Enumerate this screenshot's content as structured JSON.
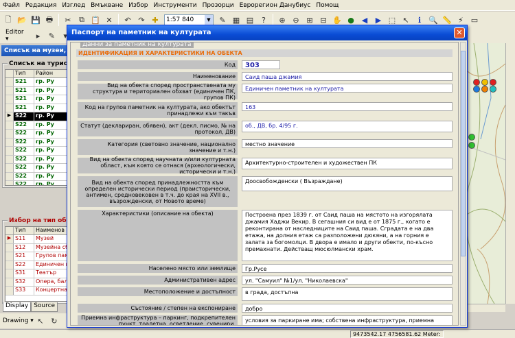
{
  "menu": [
    "Файл",
    "Редакция",
    "Изглед",
    "Вмъкване",
    "Избор",
    "Инструменти",
    "Прозорци",
    "Еврорегион Данубиус",
    "Помощ"
  ],
  "toolbar": {
    "scale": "1:57 840"
  },
  "editor_label": "Editor",
  "left_panel": {
    "title": "Списък на музеи, п",
    "group1_label": "Списък на туристи",
    "group1_cols": [
      "Тип",
      "Район"
    ],
    "group1_rows": [
      {
        "type": "S21",
        "area": "гр. Ру",
        "color": "#006400"
      },
      {
        "type": "S21",
        "area": "гр. Ру",
        "color": "#006400"
      },
      {
        "type": "S21",
        "area": "гр. Ру",
        "color": "#006400"
      },
      {
        "type": "S21",
        "area": "гр. Ру",
        "color": "#006400"
      },
      {
        "type": "S22",
        "area": "гр. Ру",
        "color": "#006400",
        "selected": true
      },
      {
        "type": "S22",
        "area": "гр. Ру",
        "color": "#006400"
      },
      {
        "type": "S22",
        "area": "гр. Ру",
        "color": "#006400"
      },
      {
        "type": "S22",
        "area": "гр. Ру",
        "color": "#006400"
      },
      {
        "type": "S22",
        "area": "гр. Ру",
        "color": "#006400"
      },
      {
        "type": "S22",
        "area": "гр. Ру",
        "color": "#006400"
      },
      {
        "type": "S22",
        "area": "гр. Ру",
        "color": "#006400"
      },
      {
        "type": "S22",
        "area": "гр. Ру",
        "color": "#006400"
      },
      {
        "type": "S22",
        "area": "гр. Ру",
        "color": "#006400"
      }
    ],
    "group2_label": "Избор на тип обект",
    "group2_cols": [
      "Тип",
      "Наименов"
    ],
    "group2_rows": [
      {
        "type": "S11",
        "name": "Музей",
        "color": "#b00000",
        "current": true
      },
      {
        "type": "S12",
        "name": "Музейна сбі",
        "color": "#b00000"
      },
      {
        "type": "S21",
        "name": "Групов памі",
        "color": "#b00000"
      },
      {
        "type": "S22",
        "name": "Единичен пі",
        "color": "#b00000"
      },
      {
        "type": "S31",
        "name": "Театър",
        "color": "#b00000"
      },
      {
        "type": "S32",
        "name": "Опера, бал",
        "color": "#b00000"
      },
      {
        "type": "S33",
        "name": "Концертна",
        "color": "#b00000"
      }
    ],
    "tabs": [
      "Display",
      "Source"
    ]
  },
  "drawing_label": "Drawing",
  "status": {
    "coords": "9473542.17  4756581.62 Meter:"
  },
  "dialog": {
    "title": "Паспорт на паметник на културата",
    "legend": "Данни за паметник на културата",
    "section": "ИДЕНТИФИКАЦИЯ И ХАРАКТЕРИСТИКИ НА ОБЕКТА",
    "rows": [
      {
        "label": "Код",
        "value": "303"
      },
      {
        "label": "Наименование",
        "value": "Саид паша джамия"
      },
      {
        "label": "Вид на обекта според пространствената му структура и териториален обхват (единичен ПК, групов ПК)",
        "value": "Единичен паметник на културата"
      },
      {
        "label": "Код на групов паметник на културата, ако обектът принадлежи към такъв",
        "value": "163"
      },
      {
        "label": "Статут (деклариран, обявен), акт (декл. писмо, № на протокол, ДВ)",
        "value": "об., ДВ, бр. 4/95 г."
      },
      {
        "label": "Категория (световно значение, национално значение и т.н.)",
        "value": "местно значение"
      },
      {
        "label": "Вид на обекта според научната и/или културната област, към която се отнася (археологически, исторически и т.н.)",
        "value": "Архитектурно-строителен и художествен ПК"
      },
      {
        "label": "Вид на обекта според принадлежността към определен исторически период (праисторически, антимен, средновековен в т.ч. до края на XVII в., възрожденски, от Новото време)",
        "value": "Доосвобожденски ( Възраждане)"
      },
      {
        "label": "Характеристики (описание на обекта)",
        "value": "Построена през 1839 г. от Саид паша на мястото на изгорялата джамия Хаджи Векир. В сегашния си вид е от 1875 г., когато е реконтирана от наследниците на Саид паша. Сградата е на два етажа, на долния етаж са разположени дюкяни, а на горния е залата за богомолци. В двора е имало и други обекти, по-късно премахнати. Действащ мюсюлмански храм."
      },
      {
        "label": "Населено място или землище",
        "value": "Гр.Русе"
      },
      {
        "label": "Административен адрес",
        "value": "ул. \"Самуил\" №1/ул. \"Николаевска\""
      },
      {
        "label": "Местоположение и достъпност",
        "value": "в града, достъпна"
      },
      {
        "label": "Състояние / степен на експониране",
        "value": "добро"
      },
      {
        "label": "Приемна инфраструктура – паркинг, подкрепителен пункт, тоалетна, осветление, сувенири, туристическа",
        "value": "условия за паркиране има; собствена инфраструктура, приемна туристическа - няма"
      }
    ]
  }
}
